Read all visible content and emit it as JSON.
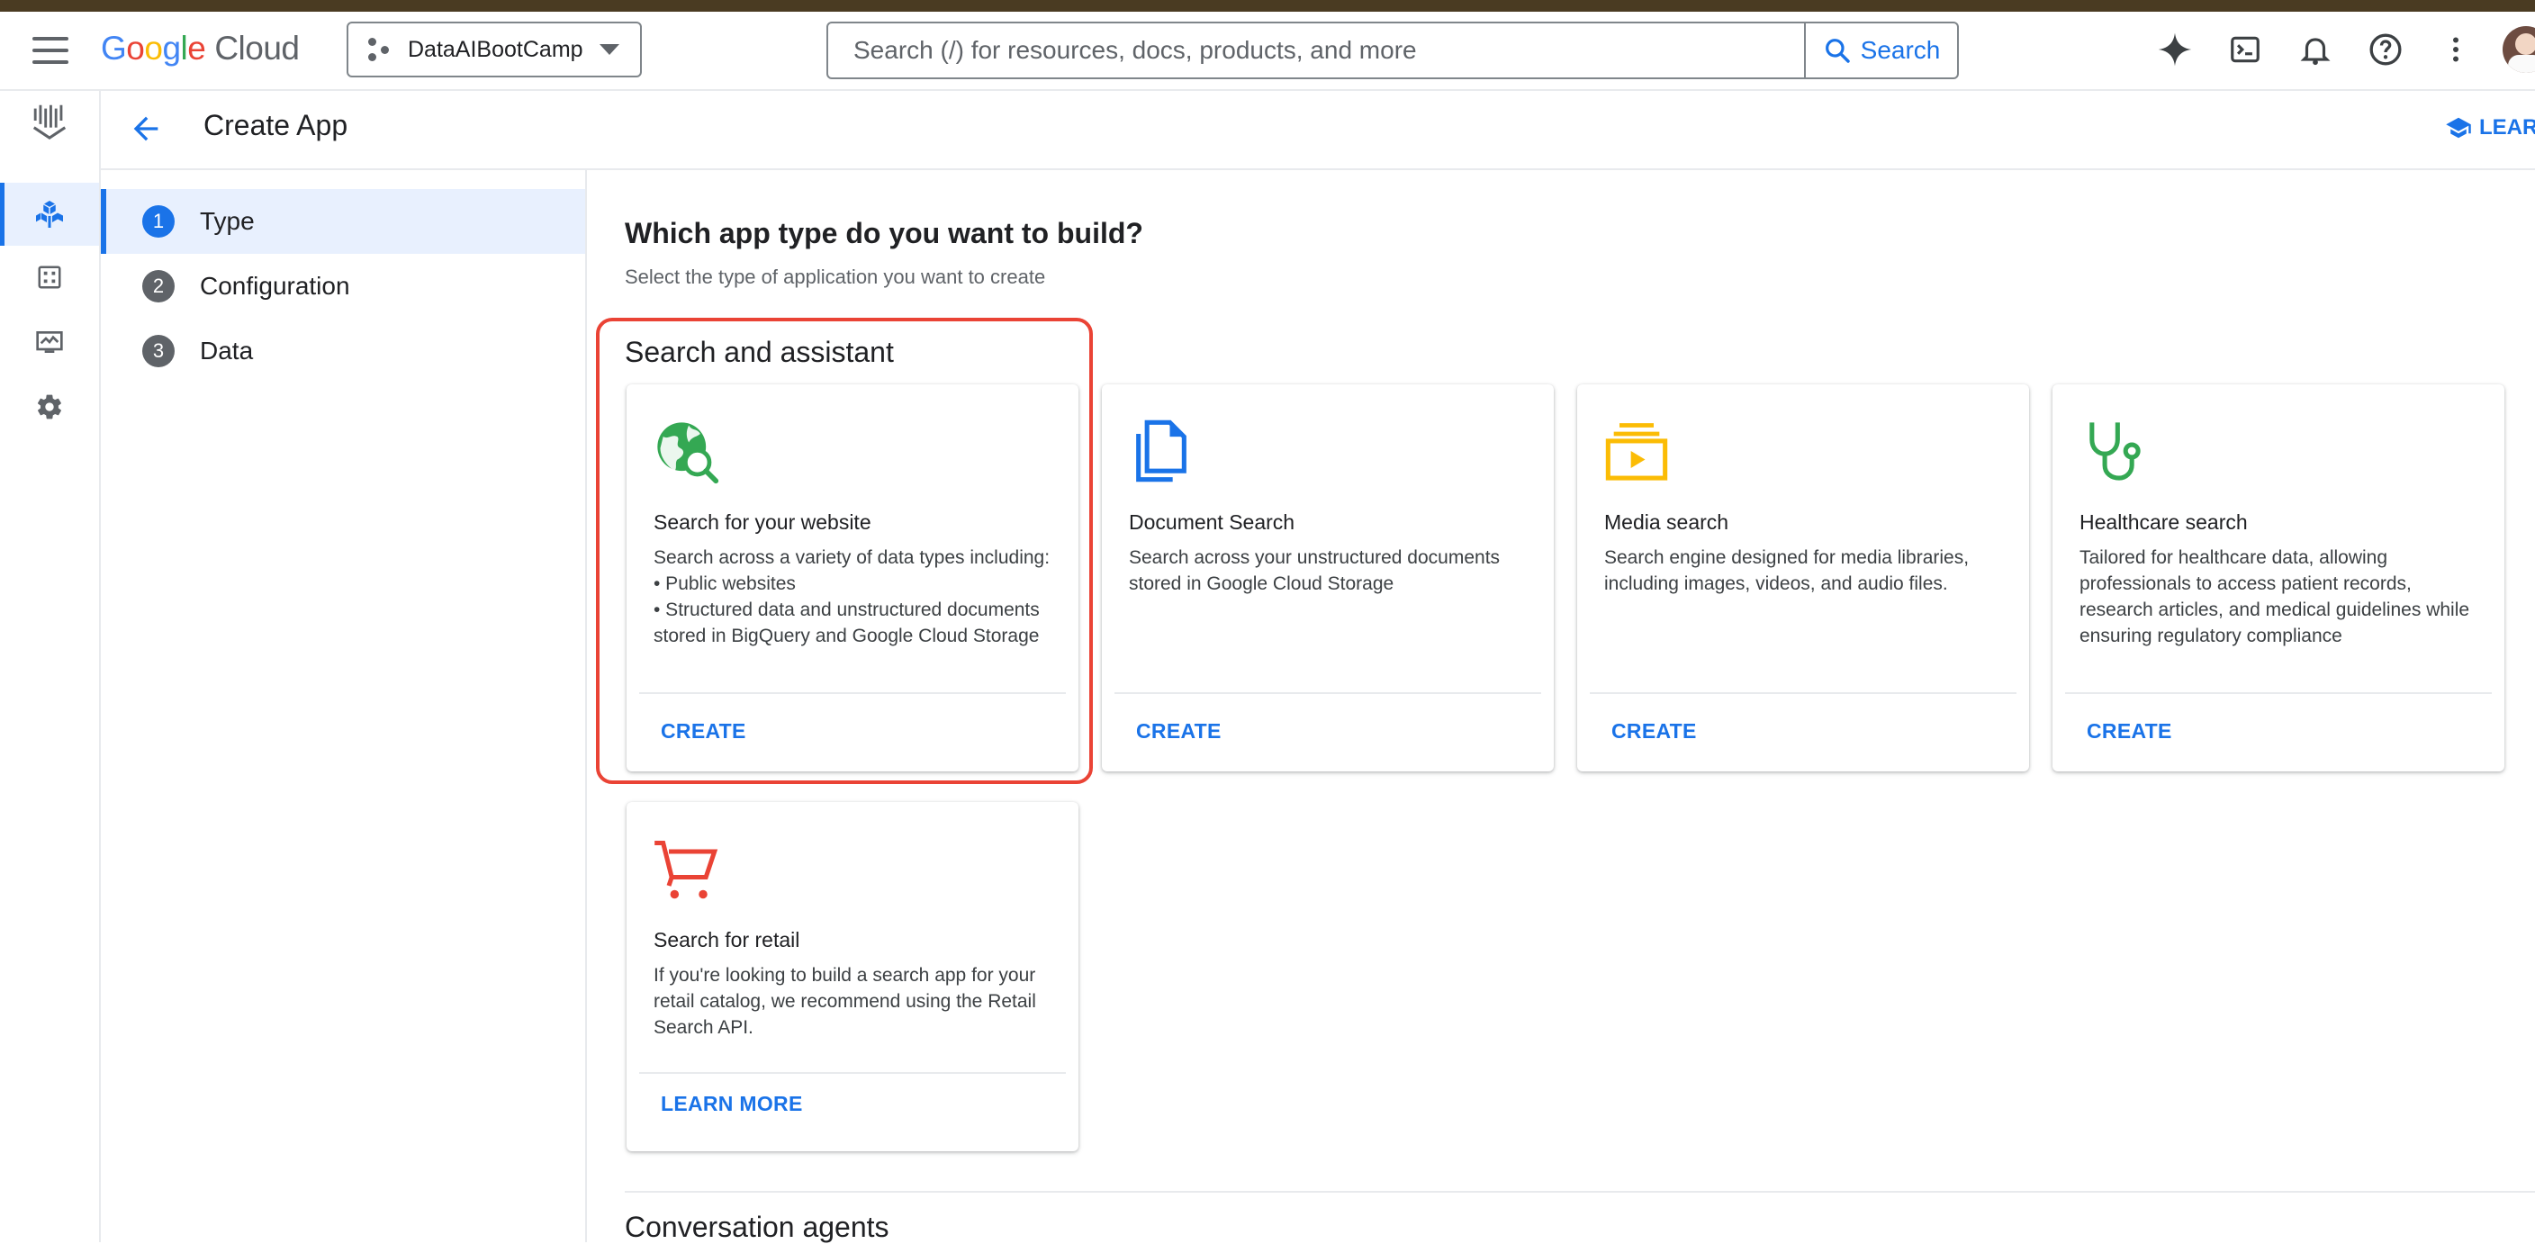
{
  "topbar": {
    "brand_letters": [
      "G",
      "o",
      "o",
      "g",
      "l",
      "e"
    ],
    "brand_suffix": "Cloud",
    "project": "DataAIBootCamp",
    "search_placeholder": "Search (/) for resources, docs, products, and more",
    "search_button": "Search",
    "icons": [
      "gemini-spark-icon",
      "cloud-shell-icon",
      "notifications-bell-icon",
      "help-icon",
      "more-vert-icon"
    ]
  },
  "subheader": {
    "title": "Create App",
    "learn_label": "LEARN"
  },
  "rail": {
    "icons": [
      "ai-applications-logo-icon",
      "apps-cube-icon",
      "data-stores-icon",
      "monitoring-icon",
      "settings-gear-icon"
    ]
  },
  "stepper": {
    "steps": [
      {
        "num": "1",
        "label": "Type"
      },
      {
        "num": "2",
        "label": "Configuration"
      },
      {
        "num": "3",
        "label": "Data"
      }
    ]
  },
  "main": {
    "question": "Which app type do you want to build?",
    "subtitle": "Select the type of application you want to create",
    "section_title": "Search and assistant",
    "next_section_title": "Conversation agents",
    "cards": [
      {
        "icon": "globe-search-icon",
        "title": "Search for your website",
        "description": "Search across a variety of data types including:\n• Public websites\n• Structured data and unstructured documents stored in BigQuery and Google Cloud Storage",
        "action": "CREATE"
      },
      {
        "icon": "document-icon",
        "title": "Document Search",
        "description": "Search across your unstructured documents stored in Google Cloud Storage",
        "action": "CREATE"
      },
      {
        "icon": "media-video-icon",
        "title": "Media search",
        "description": "Search engine designed for media libraries, including images, videos, and audio files.",
        "action": "CREATE"
      },
      {
        "icon": "stethoscope-icon",
        "title": "Healthcare search",
        "description": "Tailored for healthcare data, allowing professionals to access patient records, research articles, and medical guidelines while ensuring regulatory compliance",
        "action": "CREATE"
      },
      {
        "icon": "shopping-cart-icon",
        "title": "Search for retail",
        "description": "If you're looking to build a search app for your retail catalog, we recommend using the Retail Search API.",
        "action": "LEARN MORE"
      }
    ]
  },
  "colors": {
    "accent": "#1a73e8",
    "highlight": "#ea4335",
    "globe_green": "#34a853",
    "document_blue": "#1a73e8",
    "media_yellow": "#fbbc05",
    "stethoscope_green": "#34a853",
    "cart_red": "#ea4335"
  }
}
